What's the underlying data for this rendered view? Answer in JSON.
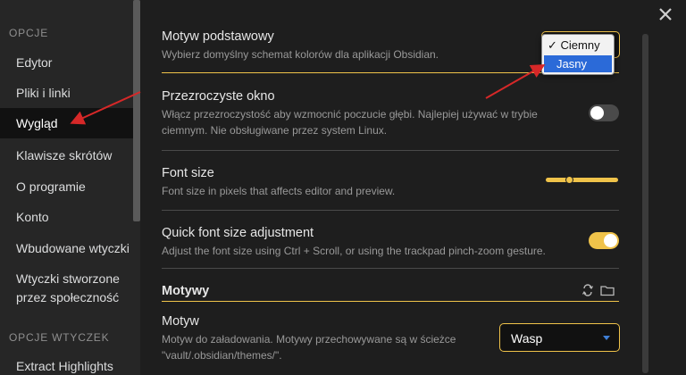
{
  "sidebar": {
    "section_options": "OPCJE",
    "section_plugin_options": "OPCJE WTYCZEK",
    "items": [
      {
        "label": "Edytor"
      },
      {
        "label": "Pliki i linki"
      },
      {
        "label": "Wygląd"
      },
      {
        "label": "Klawisze skrótów"
      },
      {
        "label": "O programie"
      },
      {
        "label": "Konto"
      },
      {
        "label": "Wbudowane wtyczki"
      },
      {
        "label": "Wtyczki stworzone",
        "label2": "przez społeczność"
      },
      {
        "label": "Extract Highlights"
      }
    ]
  },
  "settings": {
    "base_theme": {
      "name": "Motyw podstawowy",
      "desc": "Wybierz domyślny schemat kolorów dla aplikacji Obsidian.",
      "options": [
        "Ciemny",
        "Jasny"
      ],
      "checked": "✓"
    },
    "translucent": {
      "name": "Przezroczyste okno",
      "desc1": "Włącz przezroczystość aby wzmocnić poczucie głębi. Najlepiej używać w trybie",
      "desc2": "ciemnym. Nie obsługiwane przez system Linux."
    },
    "font_size": {
      "name": "Font size",
      "desc": "Font size in pixels that affects editor and preview."
    },
    "quick_font": {
      "name": "Quick font size adjustment",
      "desc": "Adjust the font size using Ctrl + Scroll, or using the trackpad pinch-zoom gesture."
    },
    "themes_heading": "Motywy",
    "theme": {
      "name": "Motyw",
      "desc1": "Motyw do załadowania. Motywy przechowywane są w ścieżce",
      "desc2": "\"vault/.obsidian/themes/\".",
      "value": "Wasp"
    }
  },
  "colors": {
    "accent": "#f0c34a",
    "annotation_arrow": "#d62828",
    "highlight": "#2b6ad8"
  }
}
